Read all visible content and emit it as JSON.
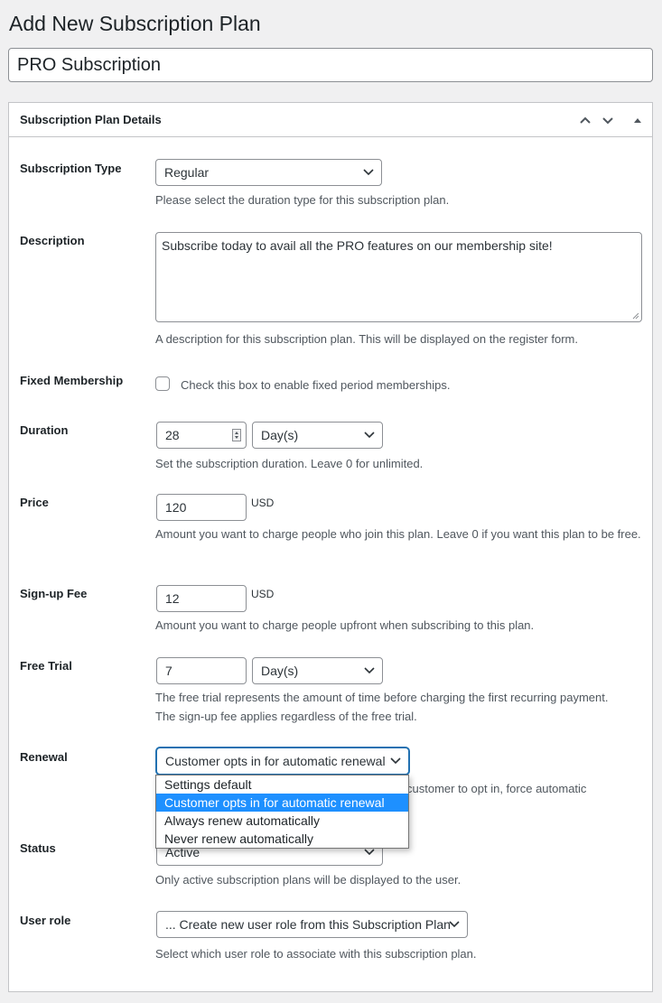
{
  "page": {
    "title": "Add New Subscription Plan",
    "plan_name_value": "PRO Subscription"
  },
  "metabox": {
    "title": "Subscription Plan Details",
    "controls": [
      "move-up",
      "move-down",
      "toggle-panel"
    ]
  },
  "fields": {
    "subscription_type": {
      "label": "Subscription Type",
      "value": "Regular",
      "description": "Please select the duration type for this subscription plan."
    },
    "description": {
      "label": "Description",
      "value": "Subscribe today to avail all the PRO features on our membership site!",
      "description": "A description for this subscription plan. This will be displayed on the register form."
    },
    "fixed_membership": {
      "label": "Fixed Membership",
      "checked": false,
      "checkbox_label": "Check this box to enable fixed period memberships."
    },
    "duration": {
      "label": "Duration",
      "value": "28",
      "unit": "Day(s)",
      "description": "Set the subscription duration. Leave 0 for unlimited."
    },
    "price": {
      "label": "Price",
      "value": "120",
      "currency": "USD",
      "description": "Amount you want to charge people who join this plan. Leave 0 if you want this plan to be free."
    },
    "signup_fee": {
      "label": "Sign-up Fee",
      "value": "12",
      "currency": "USD",
      "description": "Amount you want to charge people upfront when subscribing to this plan."
    },
    "free_trial": {
      "label": "Free Trial",
      "value": "7",
      "unit": "Day(s)",
      "description": "The free trial represents the amount of time before charging the first recurring payment. The sign-up fee applies regardless of the free trial."
    },
    "renewal": {
      "label": "Renewal",
      "value": "Customer opts in for automatic renewal",
      "description_visible": "customer to opt in, force automatic",
      "options": [
        "Settings default",
        "Customer opts in for automatic renewal",
        "Always renew automatically",
        "Never renew automatically"
      ],
      "selected_index": 1
    },
    "status": {
      "label": "Status",
      "value": "Active",
      "description": "Only active subscription plans will be displayed to the user."
    },
    "user_role": {
      "label": "User role",
      "value": "... Create new user role from this Subscription Plan",
      "description": "Select which user role to associate with this subscription plan."
    }
  },
  "colors": {
    "accent": "#2271b1",
    "dropdown_highlight": "#1e90ff",
    "background": "#f0f0f1"
  }
}
